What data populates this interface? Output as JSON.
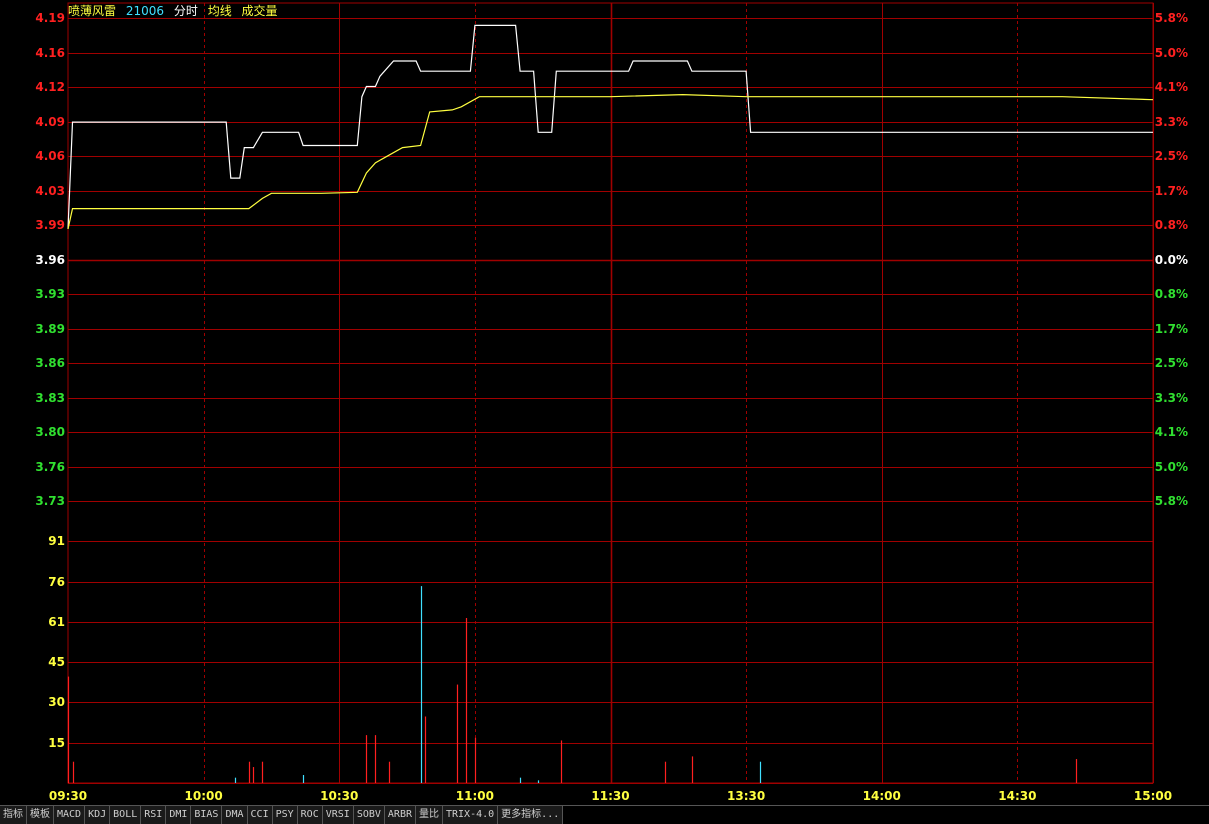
{
  "header": {
    "stock_name": "喷薄风雷",
    "stock_code": "21006",
    "label_timeshare": "分时",
    "label_avg": "均线",
    "label_volume": "成交量"
  },
  "colors": {
    "up": "#ff2020",
    "down": "#30e030",
    "flat": "#ffffff",
    "price_line": "#ffffff",
    "avg_line": "#ffff40",
    "grid": "#a00000",
    "vol_up": "#ff2020",
    "vol_down": "#40e0ff",
    "vol_label": "#ffff40"
  },
  "price_axis": {
    "left_labels": [
      "4.19",
      "4.16",
      "4.12",
      "4.09",
      "4.06",
      "4.03",
      "3.99",
      "3.96",
      "3.93",
      "3.89",
      "3.86",
      "3.83",
      "3.80",
      "3.76",
      "3.73"
    ],
    "right_labels": [
      "5.8%",
      "5.0%",
      "4.1%",
      "3.3%",
      "2.5%",
      "1.7%",
      "0.8%",
      "0.0%",
      "0.8%",
      "1.7%",
      "2.5%",
      "3.3%",
      "4.1%",
      "5.0%",
      "5.8%"
    ]
  },
  "volume_axis": {
    "labels": [
      "91",
      "76",
      "61",
      "45",
      "30",
      "15"
    ]
  },
  "time_axis": {
    "labels": [
      "09:30",
      "10:00",
      "10:30",
      "11:00",
      "11:30",
      "13:30",
      "14:00",
      "14:30",
      "15:00"
    ]
  },
  "chart_data": {
    "type": "line",
    "series": [
      {
        "points": [
          [
            0,
            3.99
          ],
          [
            1,
            4.095
          ],
          [
            35,
            4.095
          ],
          [
            36,
            4.04
          ],
          [
            38,
            4.04
          ],
          [
            39,
            4.07
          ],
          [
            41,
            4.07
          ],
          [
            43,
            4.085
          ],
          [
            51,
            4.085
          ],
          [
            52,
            4.072
          ],
          [
            64,
            4.072
          ],
          [
            65,
            4.12
          ],
          [
            66,
            4.13
          ],
          [
            68,
            4.13
          ],
          [
            69,
            4.14
          ],
          [
            72,
            4.155
          ],
          [
            77,
            4.155
          ],
          [
            78,
            4.145
          ],
          [
            89,
            4.145
          ],
          [
            90,
            4.19
          ],
          [
            99,
            4.19
          ],
          [
            100,
            4.145
          ],
          [
            103,
            4.145
          ],
          [
            104,
            4.085
          ],
          [
            107,
            4.085
          ],
          [
            108,
            4.145
          ],
          [
            124,
            4.145
          ],
          [
            125,
            4.155
          ],
          [
            137,
            4.155
          ],
          [
            138,
            4.145
          ],
          [
            150,
            4.145
          ],
          [
            151,
            4.085
          ],
          [
            240,
            4.085
          ]
        ]
      },
      {
        "points": [
          [
            0,
            3.99
          ],
          [
            1,
            4.01
          ],
          [
            40,
            4.01
          ],
          [
            43,
            4.02
          ],
          [
            45,
            4.025
          ],
          [
            56,
            4.025
          ],
          [
            64,
            4.026
          ],
          [
            66,
            4.045
          ],
          [
            68,
            4.055
          ],
          [
            70,
            4.06
          ],
          [
            74,
            4.07
          ],
          [
            78,
            4.072
          ],
          [
            80,
            4.105
          ],
          [
            85,
            4.107
          ],
          [
            87,
            4.11
          ],
          [
            91,
            4.12
          ],
          [
            120,
            4.12
          ],
          [
            136,
            4.122
          ],
          [
            150,
            4.12
          ],
          [
            220,
            4.12
          ],
          [
            240,
            4.117
          ]
        ]
      }
    ],
    "volume": [
      {
        "t": 0,
        "v": 40,
        "dir": "up"
      },
      {
        "t": 1,
        "v": 8,
        "dir": "up"
      },
      {
        "t": 37,
        "v": 2,
        "dir": "down"
      },
      {
        "t": 40,
        "v": 8,
        "dir": "up"
      },
      {
        "t": 41,
        "v": 6,
        "dir": "up"
      },
      {
        "t": 43,
        "v": 8,
        "dir": "up"
      },
      {
        "t": 52,
        "v": 3,
        "dir": "down"
      },
      {
        "t": 66,
        "v": 18,
        "dir": "up"
      },
      {
        "t": 68,
        "v": 18,
        "dir": "up"
      },
      {
        "t": 71,
        "v": 8,
        "dir": "up"
      },
      {
        "t": 78,
        "v": 74,
        "dir": "down"
      },
      {
        "t": 79,
        "v": 25,
        "dir": "up"
      },
      {
        "t": 86,
        "v": 37,
        "dir": "up"
      },
      {
        "t": 88,
        "v": 62,
        "dir": "up"
      },
      {
        "t": 90,
        "v": 17,
        "dir": "up"
      },
      {
        "t": 100,
        "v": 2,
        "dir": "down"
      },
      {
        "t": 104,
        "v": 1,
        "dir": "down"
      },
      {
        "t": 109,
        "v": 16,
        "dir": "up"
      },
      {
        "t": 132,
        "v": 8,
        "dir": "up"
      },
      {
        "t": 138,
        "v": 10,
        "dir": "up"
      },
      {
        "t": 153,
        "v": 8,
        "dir": "down"
      },
      {
        "t": 223,
        "v": 9,
        "dir": "up"
      }
    ],
    "xlim": [
      0,
      240
    ],
    "ylim": [
      3.7227,
      4.1973
    ],
    "vol_ylim": [
      0,
      106
    ]
  },
  "tabs": [
    "指标",
    "模板",
    "MACD",
    "KDJ",
    "BOLL",
    "RSI",
    "DMI",
    "BIAS",
    "DMA",
    "CCI",
    "PSY",
    "ROC",
    "VRSI",
    "SOBV",
    "ARBR",
    "量比",
    "TRIX-4.0",
    "更多指标..."
  ]
}
